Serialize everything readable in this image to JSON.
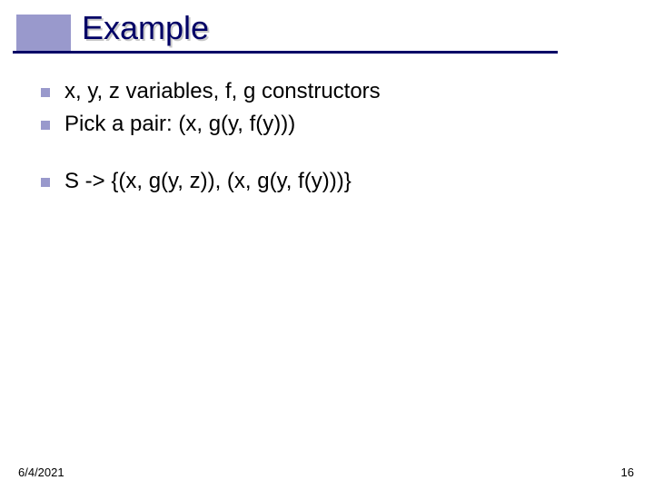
{
  "title": "Example",
  "bullets": [
    {
      "text": "x, y, z variables, f, g constructors"
    },
    {
      "text": "Pick a pair: (x, g(y, f(y)))"
    },
    {
      "text": "S -> {(x, g(y, z)), (x, g(y, f(y)))}"
    }
  ],
  "footer": {
    "date": "6/4/2021",
    "page": "16"
  }
}
